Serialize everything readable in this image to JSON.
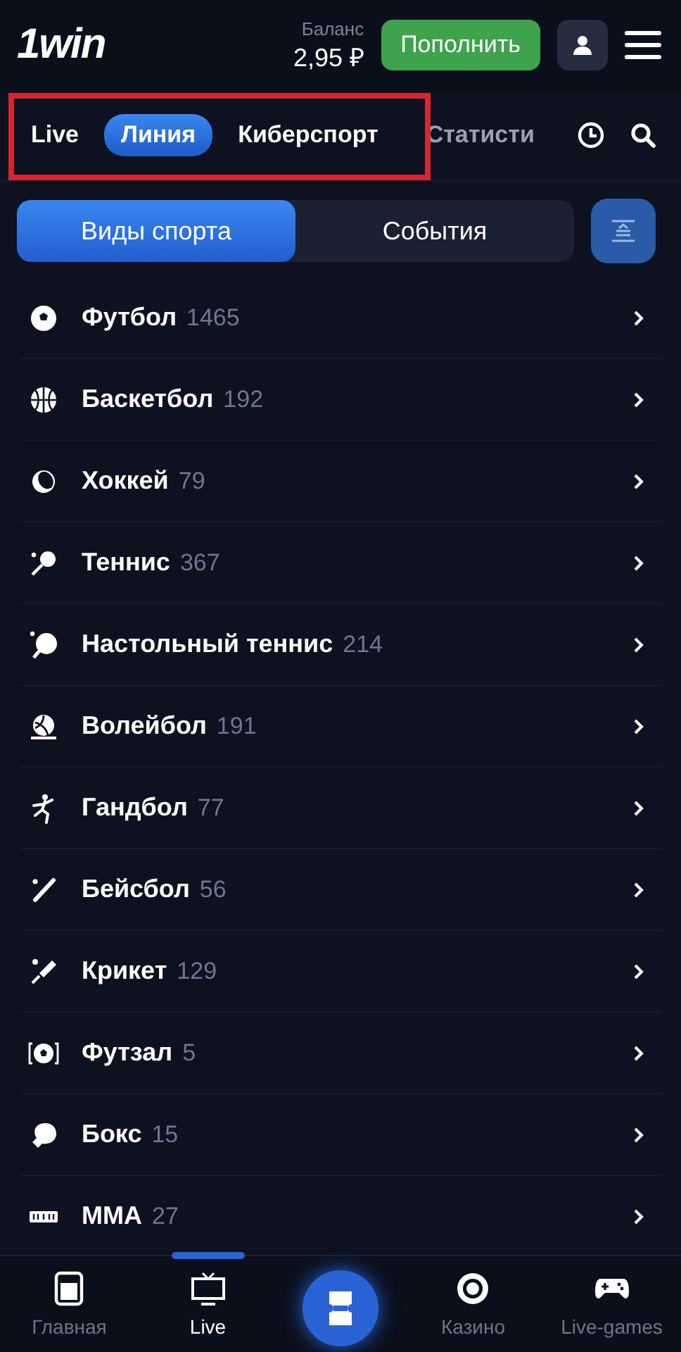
{
  "header": {
    "logo": "1win",
    "balance_label": "Баланс",
    "balance": "2,95 ₽",
    "deposit_button": "Пополнить"
  },
  "tabs": [
    {
      "label": "Live",
      "selected": false
    },
    {
      "label": "Линия",
      "selected": true
    },
    {
      "label": "Киберспорт",
      "selected": false
    },
    {
      "label": "Статисти",
      "selected": false
    }
  ],
  "view_switch": [
    {
      "label": "Виды спорта",
      "selected": true
    },
    {
      "label": "События",
      "selected": false
    }
  ],
  "sports": [
    {
      "name": "Футбол",
      "count": "1465"
    },
    {
      "name": "Баскетбол",
      "count": "192"
    },
    {
      "name": "Хоккей",
      "count": "79"
    },
    {
      "name": "Теннис",
      "count": "367"
    },
    {
      "name": "Настольный теннис",
      "count": "214"
    },
    {
      "name": "Волейбол",
      "count": "191"
    },
    {
      "name": "Гандбол",
      "count": "77"
    },
    {
      "name": "Бейсбол",
      "count": "56"
    },
    {
      "name": "Крикет",
      "count": "129"
    },
    {
      "name": "Футзал",
      "count": "5"
    },
    {
      "name": "Бокс",
      "count": "15"
    },
    {
      "name": "MMA",
      "count": "27"
    }
  ],
  "bottom_nav": [
    {
      "kind": "tab",
      "label": "Главная",
      "selected": false
    },
    {
      "kind": "tab",
      "label": "Live",
      "selected": true
    },
    {
      "kind": "center"
    },
    {
      "kind": "tab",
      "label": "Казино",
      "selected": false
    },
    {
      "kind": "tab",
      "label": "Live-games",
      "selected": false
    }
  ]
}
